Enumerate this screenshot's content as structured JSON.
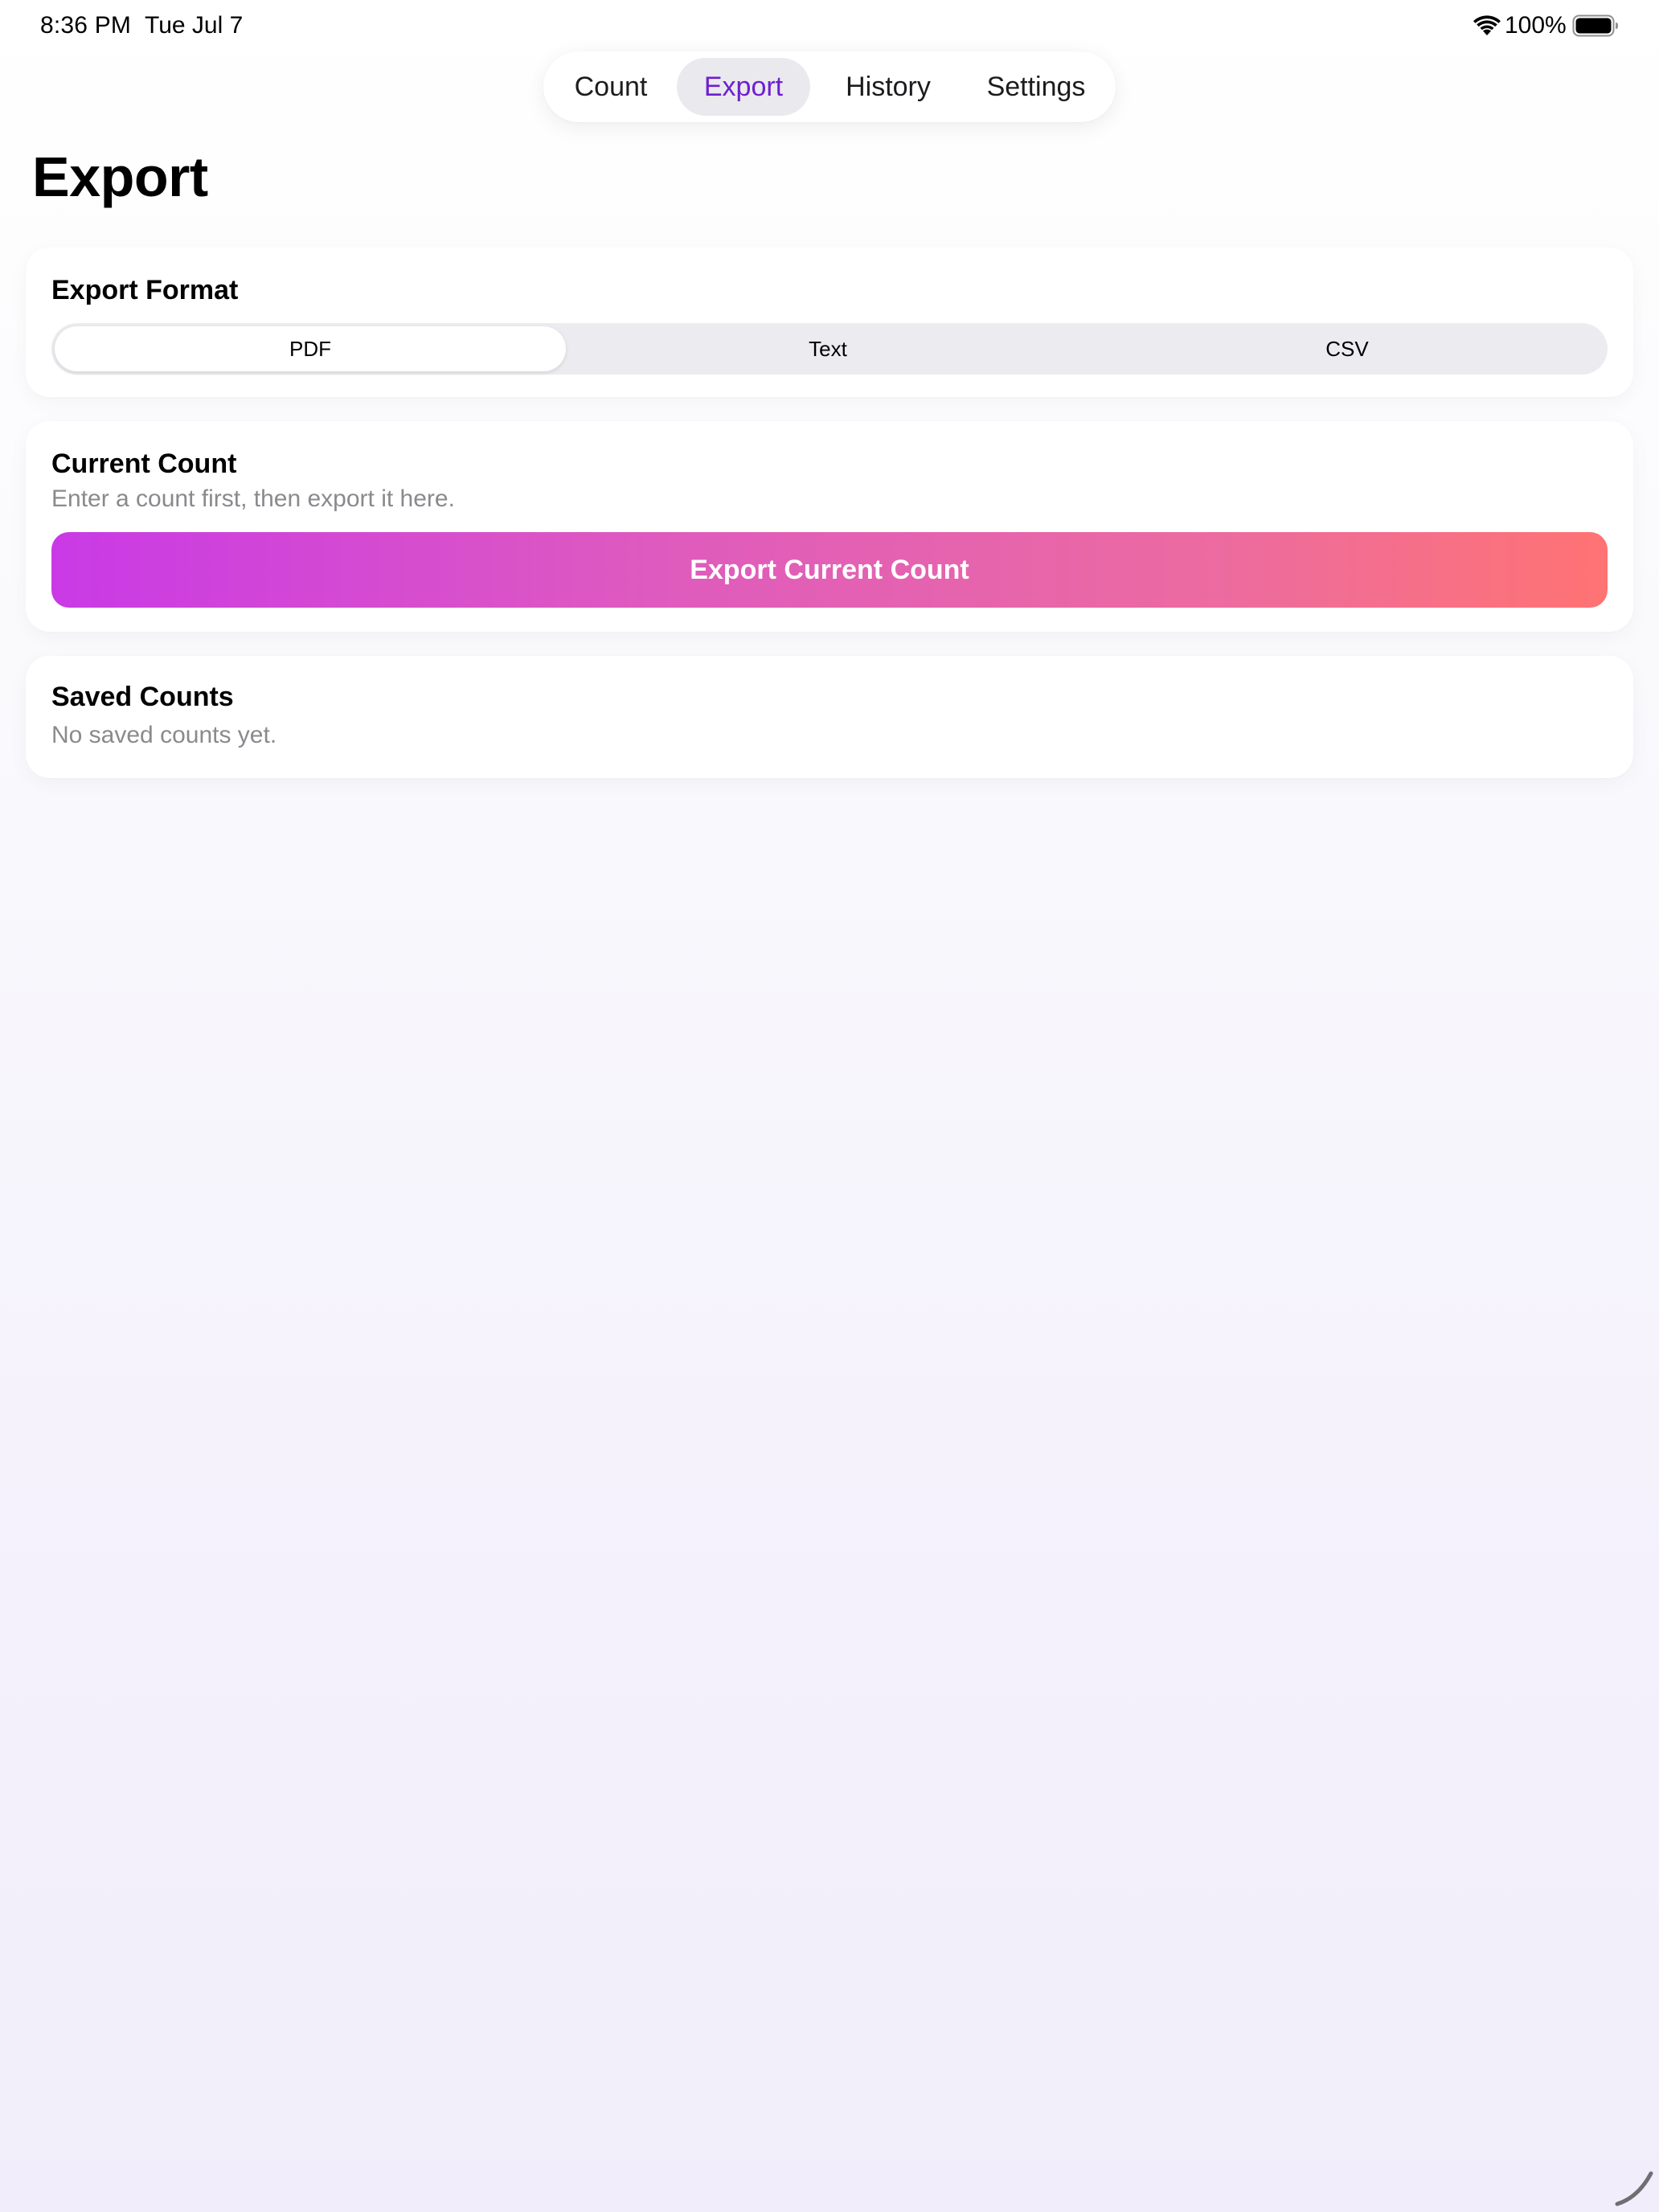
{
  "status_bar": {
    "time": "8:36 PM",
    "date": "Tue Jul 7",
    "battery": "100%"
  },
  "tabs": [
    {
      "label": "Count",
      "selected": false
    },
    {
      "label": "Export",
      "selected": true
    },
    {
      "label": "History",
      "selected": false
    },
    {
      "label": "Settings",
      "selected": false
    }
  ],
  "page": {
    "title": "Export"
  },
  "export_format": {
    "title": "Export Format",
    "options": [
      "PDF",
      "Text",
      "CSV"
    ],
    "selected": "PDF"
  },
  "current_count": {
    "title": "Current Count",
    "subtitle": "Enter a count first, then export it here.",
    "button_label": "Export Current Count"
  },
  "saved_counts": {
    "title": "Saved Counts",
    "empty_text": "No saved counts yet."
  },
  "colors": {
    "accent": "#6f1ed0",
    "button_gradient_start": "#c93ae6",
    "button_gradient_end": "#ff7373"
  },
  "icons": {
    "wifi": "wifi-icon",
    "battery": "battery-icon"
  }
}
